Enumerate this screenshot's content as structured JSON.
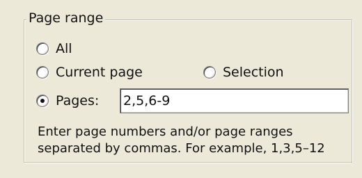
{
  "group": {
    "title": "Page range"
  },
  "options": {
    "all": {
      "label": "All",
      "checked": false
    },
    "current_page": {
      "label": "Current page",
      "checked": false
    },
    "selection": {
      "label": "Selection",
      "checked": false
    },
    "pages": {
      "label": "Pages:",
      "checked": true
    }
  },
  "pages_input": {
    "value": "2,5,6-9"
  },
  "help": {
    "line1": "Enter page numbers and/or page ranges",
    "line2": "separated by commas.  For example, 1,3,5–12"
  }
}
